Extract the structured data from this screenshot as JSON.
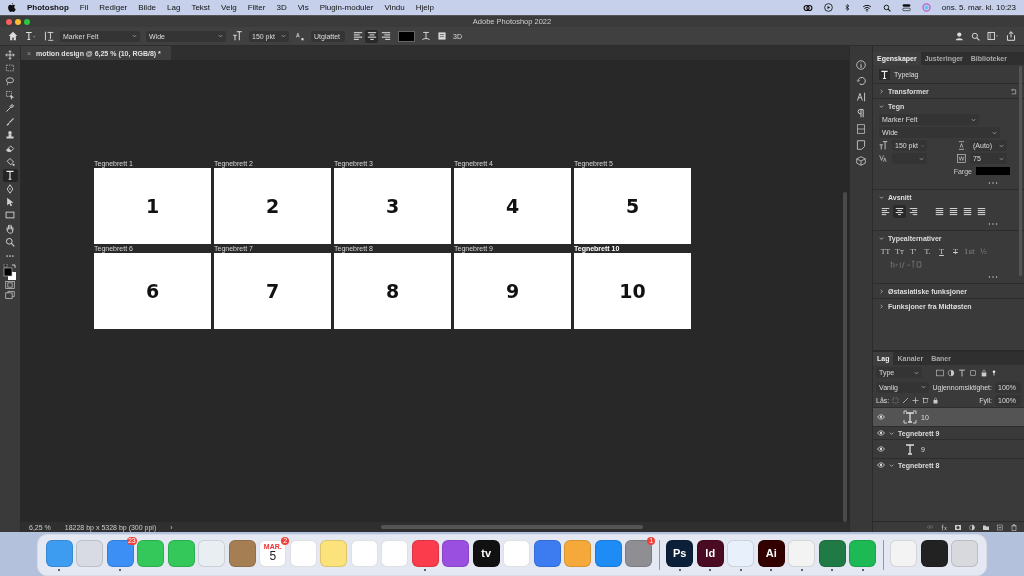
{
  "menubar": {
    "app": "Photoshop",
    "items": [
      "Fil",
      "Rediger",
      "Bilde",
      "Lag",
      "Tekst",
      "Velg",
      "Filter",
      "3D",
      "Vis",
      "Plugin-moduler",
      "Vindu",
      "Hjelp"
    ],
    "clock": "ons. 5. mar. kl. 10:23"
  },
  "window": {
    "title": "Adobe Photoshop 2022"
  },
  "options_bar": {
    "font_family": "Marker Felt",
    "font_style": "Wide",
    "font_size": "150 pkt",
    "antialias": "Utglattet",
    "align": [
      {
        "kind": "left",
        "selected": false
      },
      {
        "kind": "center",
        "selected": true
      },
      {
        "kind": "right",
        "selected": false
      }
    ],
    "button_3d": "3D"
  },
  "document_tab": {
    "close": "×",
    "title": "motion design @ 6,25 % (10, RGB/8) *"
  },
  "tools": [
    {
      "kind": "move",
      "selected": false
    },
    {
      "kind": "marquee",
      "selected": false
    },
    {
      "kind": "lasso",
      "selected": false
    },
    {
      "kind": "select",
      "selected": false
    },
    {
      "kind": "eyedropper",
      "selected": false
    },
    {
      "kind": "brush",
      "selected": false
    },
    {
      "kind": "stamp",
      "selected": false
    },
    {
      "kind": "eraser",
      "selected": false
    },
    {
      "kind": "bucket",
      "selected": false
    },
    {
      "kind": "type",
      "selected": true
    },
    {
      "kind": "pen",
      "selected": false
    },
    {
      "kind": "pointer",
      "selected": false
    },
    {
      "kind": "rectangle",
      "selected": false
    },
    {
      "kind": "hand",
      "selected": false
    },
    {
      "kind": "zoom",
      "selected": false
    },
    {
      "kind": "more",
      "selected": false
    }
  ],
  "artboards": [
    {
      "label": "Tegnebrett 1",
      "number": "1",
      "selected": false
    },
    {
      "label": "Tegnebrett 2",
      "number": "2",
      "selected": false
    },
    {
      "label": "Tegnebrett 3",
      "number": "3",
      "selected": false
    },
    {
      "label": "Tegnebrett 4",
      "number": "4",
      "selected": false
    },
    {
      "label": "Tegnebrett 5",
      "number": "5",
      "selected": false
    },
    {
      "label": "Tegnebrett 6",
      "number": "6",
      "selected": false
    },
    {
      "label": "Tegnebrett 7",
      "number": "7",
      "selected": false
    },
    {
      "label": "Tegnebrett 8",
      "number": "8",
      "selected": false
    },
    {
      "label": "Tegnebrett 9",
      "number": "9",
      "selected": false
    },
    {
      "label": "Tegnebrett 10",
      "number": "10",
      "selected": true
    }
  ],
  "status_bar": {
    "zoom": "6,25 %",
    "dimensions": "18228 bp x 5328 bp (300 ppi)",
    "arrow": "›"
  },
  "properties": {
    "tabs": [
      {
        "label": "Egenskaper",
        "selected": true
      },
      {
        "label": "Justeringer",
        "selected": false
      },
      {
        "label": "Biblioteker",
        "selected": false
      }
    ],
    "layer_type": "Typelag",
    "transform": {
      "title": "Transformer",
      "expanded": false
    },
    "character": {
      "title": "Tegn",
      "expanded": true,
      "font_family": "Marker Felt",
      "font_style": "Wide",
      "size": "150 pkt",
      "leading": "(Auto)",
      "tracking": "75",
      "color_label": "Farge"
    },
    "paragraph": {
      "title": "Avsnitt",
      "expanded": true,
      "align": [
        {
          "kind": "left",
          "selected": false
        },
        {
          "kind": "center",
          "selected": true
        },
        {
          "kind": "right",
          "selected": false
        },
        {
          "kind": "justify",
          "selected": false
        },
        {
          "kind": "justify",
          "selected": false
        },
        {
          "kind": "justify",
          "selected": false
        },
        {
          "kind": "justify",
          "selected": false
        }
      ]
    },
    "type_options": {
      "title": "Typealternativer",
      "expanded": true,
      "buttons": [
        {
          "label": "TT",
          "kind": "plain"
        },
        {
          "label": "Tт",
          "kind": "plain"
        },
        {
          "label": "T'",
          "kind": "plain"
        },
        {
          "label": "T.",
          "kind": "plain"
        },
        {
          "label": "T",
          "kind": "underline"
        },
        {
          "label": "T",
          "kind": "strike"
        },
        {
          "label": "1st",
          "kind": "dim"
        },
        {
          "label": "½",
          "kind": "dim"
        }
      ]
    },
    "collapsed_sections": [
      {
        "title": "Østasiatiske funksjoner",
        "expanded": false
      },
      {
        "title": "Funksjoner fra Midtøsten",
        "expanded": false
      }
    ]
  },
  "layers": {
    "tabs": [
      {
        "label": "Lag",
        "selected": true
      },
      {
        "label": "Kanaler",
        "selected": false
      },
      {
        "label": "Baner",
        "selected": false
      }
    ],
    "filter": "Type",
    "blend_mode": "Vanlig",
    "opacity_label": "Ugjennomsiktighet:",
    "opacity": "100%",
    "lock_label": "Lås:",
    "fill_label": "Fyll:",
    "fill": "100%",
    "items": [
      {
        "kind": "text",
        "name": "10",
        "visible": true,
        "selected": true
      },
      {
        "kind": "group",
        "name": "Tegnebrett 9",
        "visible": true,
        "selected": false,
        "expanded": true
      },
      {
        "kind": "text",
        "name": "9",
        "visible": true,
        "selected": false
      },
      {
        "kind": "group",
        "name": "Tegnebrett 8",
        "visible": true,
        "selected": false,
        "expanded": true
      }
    ]
  },
  "dock": {
    "groups": [
      [
        {
          "color": "#3d9bf0",
          "running": true
        },
        {
          "color": "#d8dbe3",
          "running": false
        },
        {
          "color": "#3b8ff5",
          "running": true,
          "badge": "23"
        },
        {
          "color": "#34c759",
          "running": false
        },
        {
          "color": "#34c759",
          "running": false
        },
        {
          "color": "#e9eef3",
          "running": false
        },
        {
          "color": "#a57e54",
          "running": false
        },
        {
          "color": "#ffffff",
          "running": false,
          "top": "MAR.",
          "label": "5",
          "badge": "2"
        },
        {
          "color": "#ffffff",
          "running": false
        },
        {
          "color": "#fbe27a",
          "running": false
        },
        {
          "color": "#ffffff",
          "running": false
        },
        {
          "color": "#ffffff",
          "running": false
        },
        {
          "color": "#fa3c4c",
          "running": true
        },
        {
          "color": "#9b4fe0",
          "running": false
        },
        {
          "color": "#111111",
          "running": false,
          "label": "tv"
        },
        {
          "color": "#ffffff",
          "running": false
        },
        {
          "color": "#3d7cf0",
          "running": false
        },
        {
          "color": "#f6a93b",
          "running": false
        },
        {
          "color": "#1e8cf5",
          "running": false
        },
        {
          "color": "#8e8e93",
          "running": false,
          "badge": "1"
        }
      ],
      [
        {
          "color": "#0b1f38",
          "running": true,
          "label": "Ps"
        },
        {
          "color": "#4a0a22",
          "running": true,
          "label": "Id"
        },
        {
          "color": "#e8f1fb",
          "running": true
        },
        {
          "color": "#330000",
          "running": true,
          "label": "Ai"
        },
        {
          "color": "#f3f3f3",
          "running": true
        },
        {
          "color": "#1f7a45",
          "running": true
        },
        {
          "color": "#1db954",
          "running": true
        }
      ],
      [
        {
          "color": "#f3f3f3",
          "running": false
        },
        {
          "color": "#222222",
          "running": false
        },
        {
          "color": "#d7d9dd",
          "running": false
        }
      ]
    ]
  }
}
